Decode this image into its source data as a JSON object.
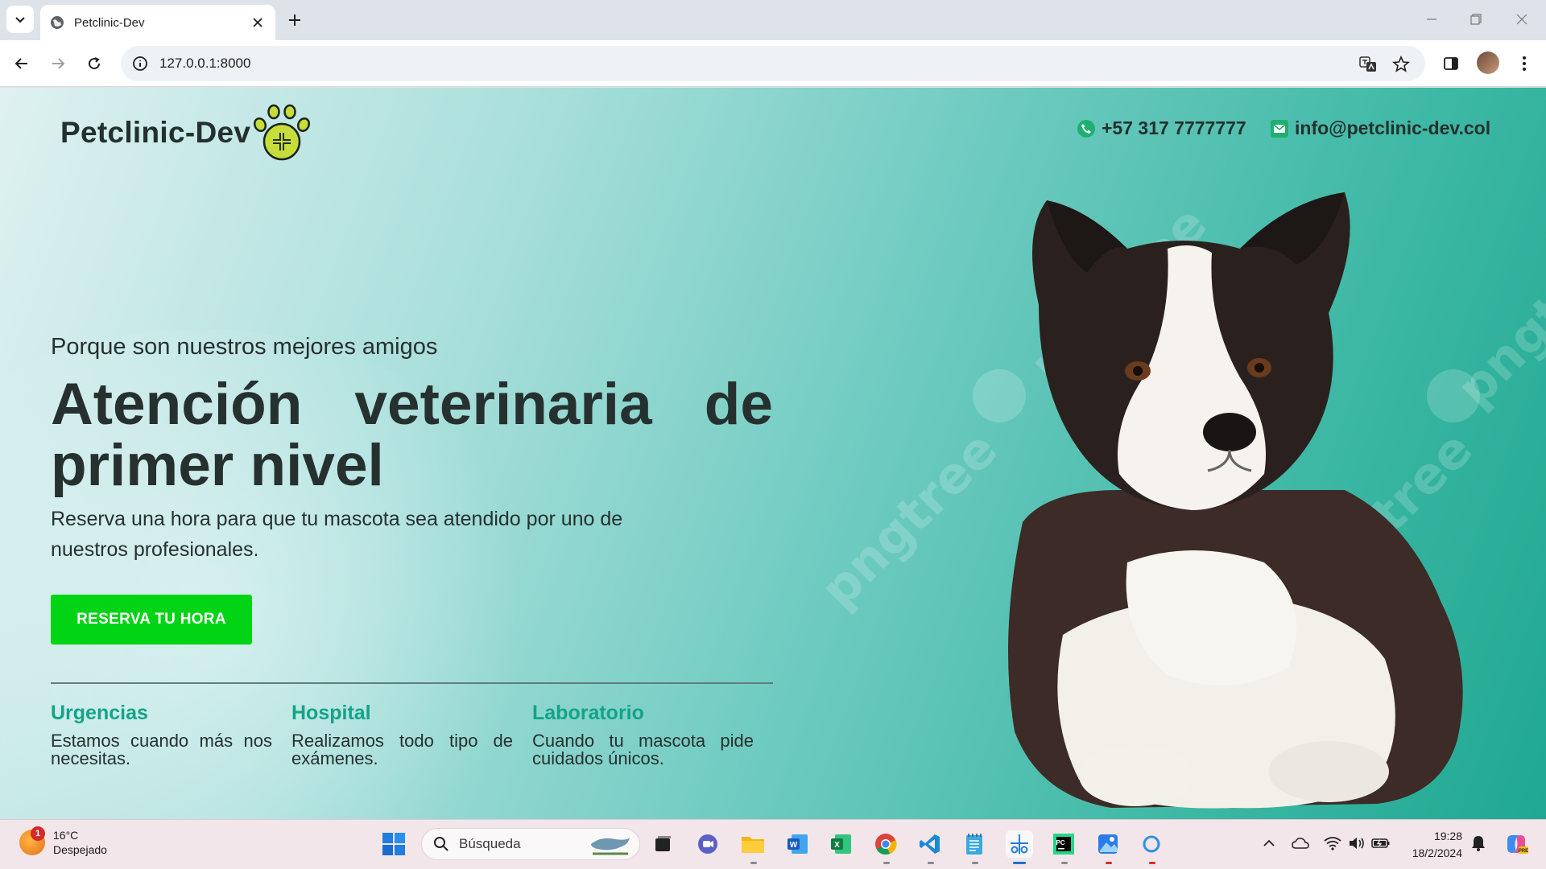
{
  "browser": {
    "tab_title": "Petclinic-Dev",
    "url": "127.0.0.1:8000"
  },
  "site": {
    "brand": "Petclinic-Dev",
    "phone": "+57 317 7777777",
    "email": "info@petclinic-dev.col",
    "hero_subtitle": "Porque son nuestros mejores amigos",
    "hero_title": "Atención veterinaria de primer nivel",
    "hero_description": "Reserva una hora para que tu mascota sea atendido por uno de nuestros profesionales.",
    "cta_label": "RESERVA TU HORA",
    "features": [
      {
        "title": "Urgencias",
        "text": "Estamos cuando más nos necesitas."
      },
      {
        "title": "Hospital",
        "text": "Realizamos todo tipo de exámenes."
      },
      {
        "title": "Laboratorio",
        "text": "Cuando tu mascota pide cuidados únicos."
      }
    ],
    "watermark": "pngtree"
  },
  "taskbar": {
    "weather_temp": "16°C",
    "weather_desc": "Despejado",
    "weather_badge": "1",
    "search_placeholder": "Búsqueda",
    "time": "19:28",
    "date": "18/2/2024"
  },
  "colors": {
    "accent_green": "#00d414",
    "feature_title": "#13a388",
    "text_dark": "#26312f"
  }
}
